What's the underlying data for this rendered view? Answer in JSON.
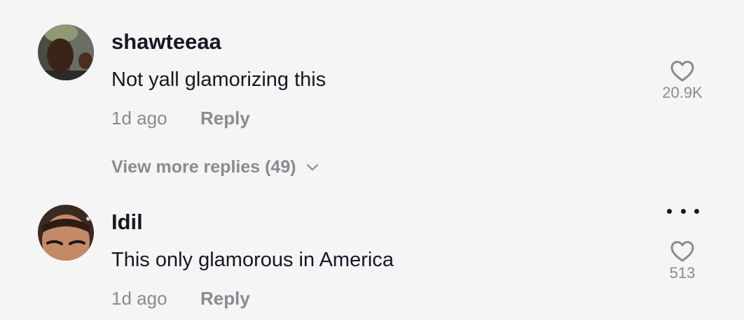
{
  "comments": [
    {
      "username": "shawteeaa",
      "text": "Not yall glamorizing this",
      "timestamp": "1d ago",
      "reply_label": "Reply",
      "likes": "20.9K"
    },
    {
      "username": "Idil",
      "text": "This only glamorous in America",
      "timestamp": "1d ago",
      "reply_label": "Reply",
      "likes": "513"
    }
  ],
  "view_more": {
    "label": "View more replies (49)"
  },
  "icons": {
    "like": "heart-icon",
    "expand": "chevron-down-icon",
    "more": "more-options-icon"
  },
  "colors": {
    "background": "#f5f5f5",
    "primary_text": "#161823",
    "secondary_text": "#8a8b91"
  }
}
